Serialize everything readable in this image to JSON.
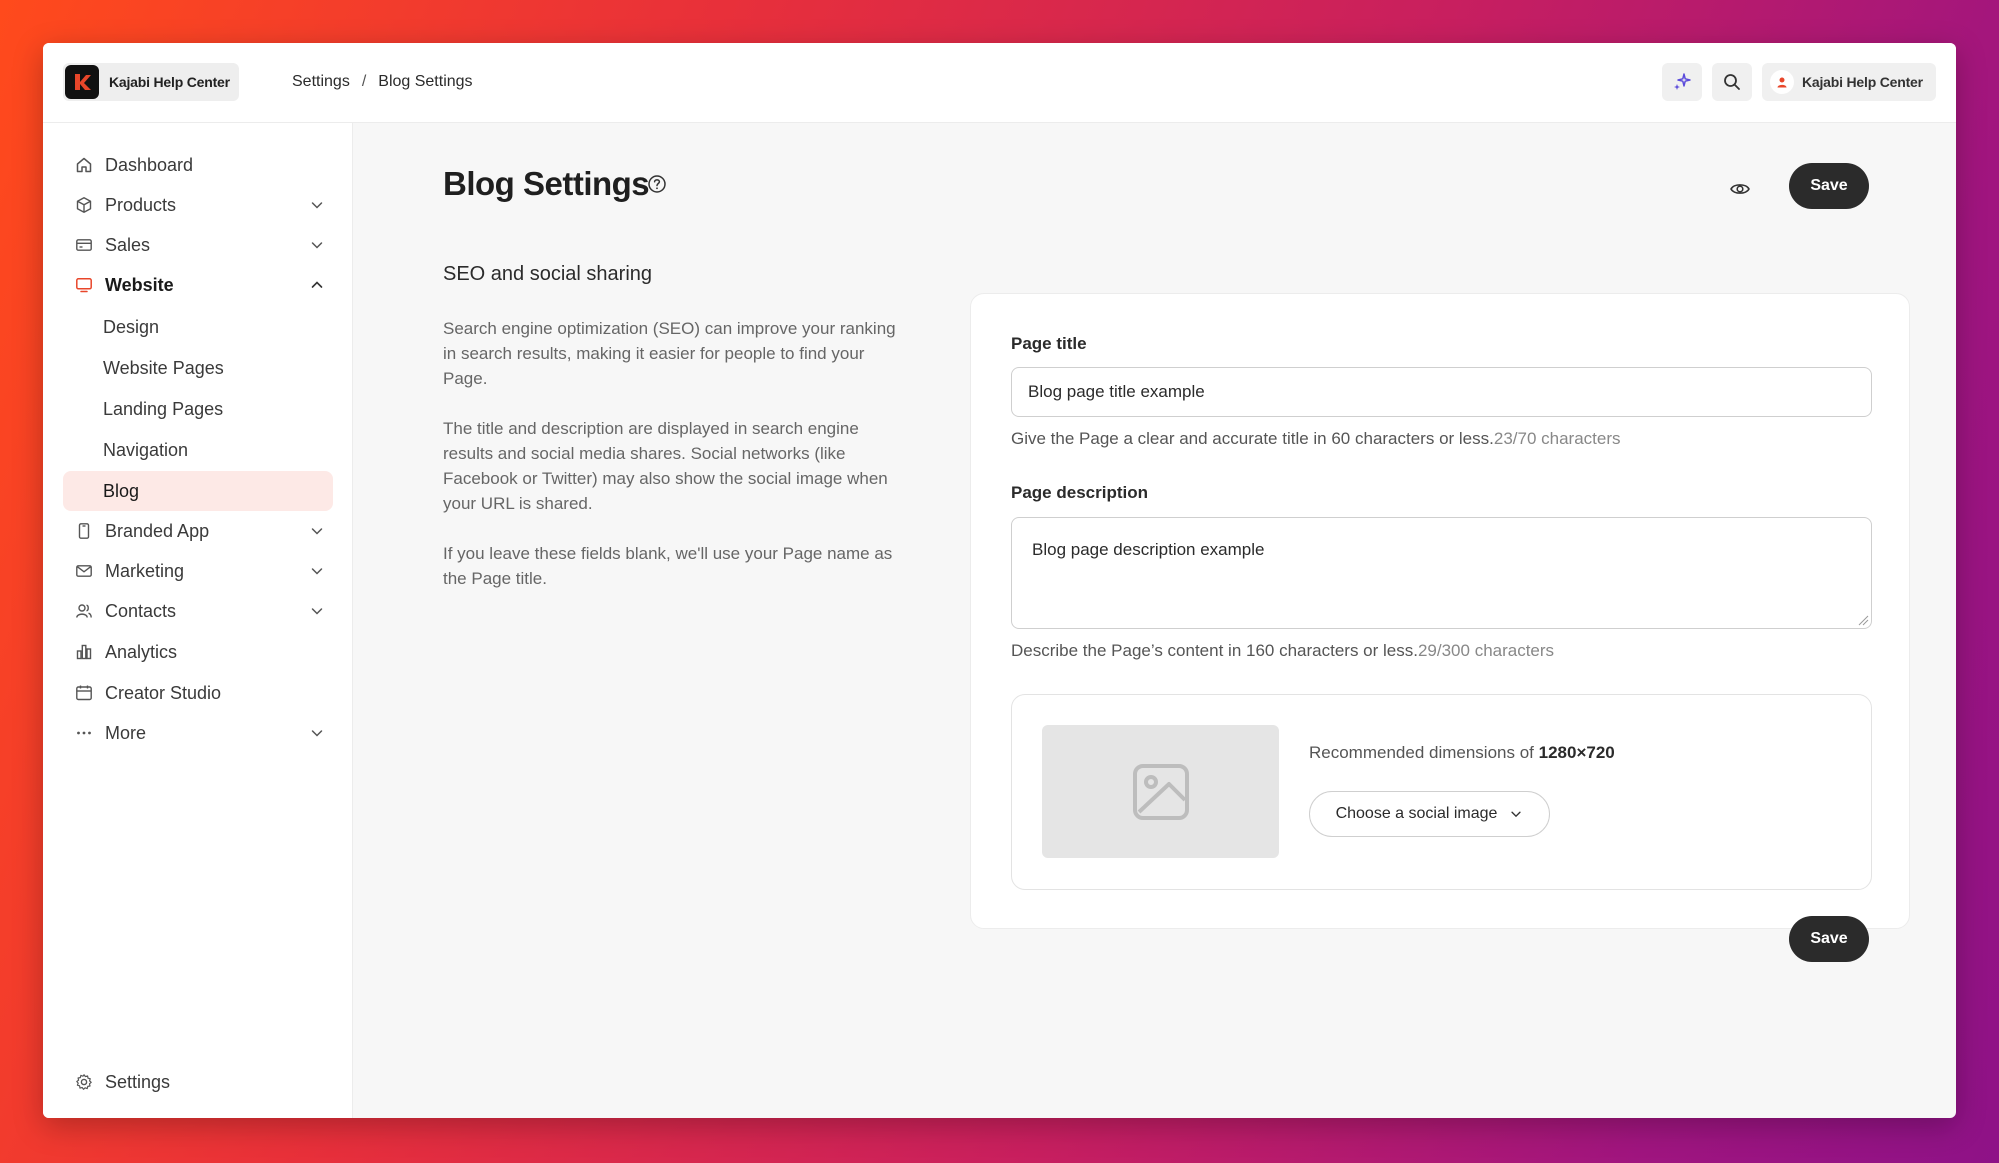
{
  "brand": {
    "name": "Kajabi Help Center"
  },
  "breadcrumb": {
    "items": [
      "Settings",
      "Blog Settings"
    ],
    "separator": "/"
  },
  "account": {
    "name": "Kajabi Help Center"
  },
  "sidebar": {
    "items": [
      {
        "label": "Dashboard",
        "icon": "home-icon"
      },
      {
        "label": "Products",
        "icon": "box-icon"
      },
      {
        "label": "Sales",
        "icon": "credit-card-icon"
      },
      {
        "label": "Website",
        "icon": "monitor-icon"
      },
      {
        "label": "Branded App",
        "icon": "phone-icon"
      },
      {
        "label": "Marketing",
        "icon": "mail-icon"
      },
      {
        "label": "Contacts",
        "icon": "users-icon"
      },
      {
        "label": "Analytics",
        "icon": "bar-chart-icon"
      },
      {
        "label": "Creator Studio",
        "icon": "calendar-icon"
      },
      {
        "label": "More",
        "icon": "ellipsis-icon"
      }
    ],
    "website_sub": [
      "Design",
      "Website Pages",
      "Landing Pages",
      "Navigation",
      "Blog"
    ],
    "settings_label": "Settings"
  },
  "main": {
    "title": "Blog Settings",
    "save_label": "Save",
    "section_title": "SEO and social sharing",
    "paragraphs": [
      "Search engine optimization (SEO) can improve your ranking in search results, making it easier for people to find your Page.",
      "The title and description are displayed in search engine results and social media shares. Social networks (like Facebook or Twitter) may also show the social image when your URL is shared.",
      "If you leave these fields blank, we'll use your Page name as the Page title."
    ],
    "page_title": {
      "label": "Page title",
      "value": "Blog page title example",
      "hint": "Give the Page a clear and accurate title in 60 characters or less.",
      "count": "23/70 characters"
    },
    "page_description": {
      "label": "Page description",
      "value": "Blog page description example",
      "hint": "Describe the Page’s content in 160 characters or less.",
      "count": "29/300 characters"
    },
    "social_image": {
      "recommended_prefix": "Recommended dimensions of ",
      "recommended_dims": "1280×720",
      "choose_label": "Choose a social image"
    }
  },
  "colors": {
    "accent": "#e8462a",
    "active_bg": "#fde9e6",
    "button_dark": "#2b2b2b",
    "sparkle": "#5b4bdb"
  }
}
